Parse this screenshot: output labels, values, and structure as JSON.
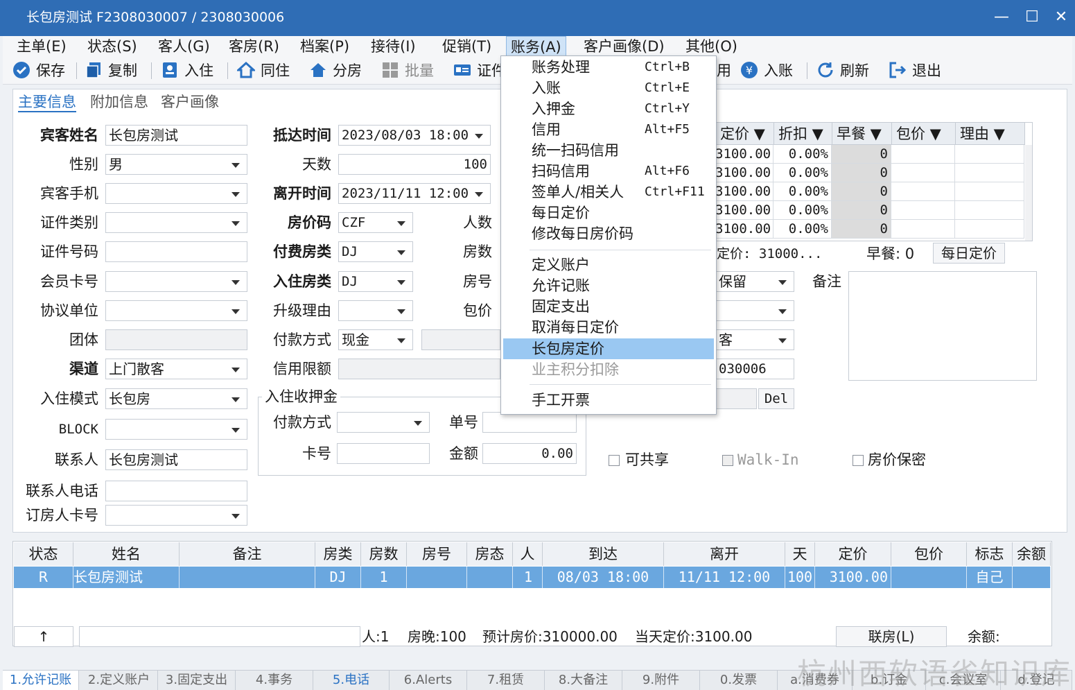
{
  "window": {
    "title": "长包房测试  F2308030007  /  2308030006",
    "minimize": "—",
    "maximize": "☐",
    "close": "✕"
  },
  "menu": [
    "主单(E)",
    "状态(S)",
    "客人(G)",
    "客房(R)",
    "档案(P)",
    "接待(I)",
    "促销(T)",
    "账务(A)",
    "客户画像(D)",
    "其他(O)"
  ],
  "toolbar": {
    "save": "保存",
    "copy": "复制",
    "checkin": "入住",
    "share": "同住",
    "assign": "分房",
    "batch": "批量",
    "cert": "证件",
    "posting": "入账",
    "refresh": "刷新",
    "exit": "退出",
    "partial": "用"
  },
  "tabs": [
    "主要信息",
    "附加信息",
    "客户画像"
  ],
  "form": {
    "guest_name_label": "宾客姓名",
    "guest_name": "长包房测试",
    "gender_label": "性别",
    "gender": "男",
    "mobile_label": "宾客手机",
    "mobile": "",
    "id_type_label": "证件类别",
    "id_type": "",
    "id_no_label": "证件号码",
    "id_no": "",
    "member_label": "会员卡号",
    "member": "",
    "company_label": "协议单位",
    "company": "",
    "group_label": "团体",
    "group": "",
    "channel_label": "渠道",
    "channel": "上门散客",
    "mode_label": "入住模式",
    "mode": "长包房",
    "block_label": "BLOCK",
    "block": "",
    "contact_label": "联系人",
    "contact": "长包房测试",
    "contact_phone_label": "联系人电话",
    "contact_phone": "",
    "booker_card_label": "订房人卡号",
    "booker_card": "",
    "arrival_label": "抵达时间",
    "arrival": "2023/08/03 18:00",
    "days_label": "天数",
    "days": "100",
    "departure_label": "离开时间",
    "departure": "2023/11/11 12:00",
    "rate_code_label": "房价码",
    "rate_code": "CZF",
    "pay_room_label": "付费房类",
    "pay_room": "DJ",
    "stay_room_label": "入住房类",
    "stay_room": "DJ",
    "upgrade_label": "升级理由",
    "upgrade": "",
    "pay_method_label": "付款方式",
    "pay_method": "现金",
    "credit_label": "信用限额",
    "credit": "",
    "persons_label": "人数",
    "rooms_label": "房数",
    "room_no_label": "房号",
    "package_label": "包价"
  },
  "deposit": {
    "title": "入住收押金",
    "pay_method_label": "付款方式",
    "pay_method": "",
    "bill_label": "单号",
    "bill": "",
    "card_label": "卡号",
    "card": "",
    "amount_label": "金额",
    "amount": "0.00"
  },
  "rate_table": {
    "headers": [
      "定价 ▼",
      "折扣 ▼",
      "早餐 ▼",
      "包价 ▼",
      "理由 ▼"
    ],
    "rows": [
      [
        "3100.00",
        "0.00%",
        "0"
      ],
      [
        "3100.00",
        "0.00%",
        "0"
      ],
      [
        "3100.00",
        "0.00%",
        "0"
      ],
      [
        "3100.00",
        "0.00%",
        "0"
      ],
      [
        "3100.00",
        "0.00%",
        "0"
      ]
    ],
    "summary": "定价: 31000...",
    "breakfast": "早餐: 0",
    "daily_btn": "每日定价"
  },
  "right": {
    "keep": "保留",
    "remark_label": "备注",
    "guest": "客",
    "account_no": "030006",
    "del_btn": "Del"
  },
  "checks": {
    "share": "可共享",
    "walkin": "Walk-In",
    "keep_rate": "房价保密"
  },
  "list": {
    "headers": [
      "状态",
      "姓名",
      "备注",
      "房类",
      "房数",
      "房号",
      "房态",
      "人",
      "到达",
      "离开",
      "天",
      "定价",
      "包价",
      "标志",
      "余额"
    ],
    "row": [
      "R",
      "长包房测试",
      "",
      "DJ",
      "1",
      "",
      "",
      "1",
      "08/03 18:00",
      "11/11 12:00",
      "100",
      "3100.00",
      "",
      "自己",
      ""
    ]
  },
  "footer": {
    "up": "↑",
    "persons": "人:1",
    "nights": "房晚:100",
    "est_rate": "预计房价:310000.00",
    "today_rate": "当天定价:3100.00",
    "link_btn": "联房(L)",
    "balance": "余额:"
  },
  "bottom_tabs": [
    "1.允许记账",
    "2.定义账户",
    "3.固定支出",
    "4.事务",
    "5.电话",
    "6.Alerts",
    "7.租赁",
    "8.大备注",
    "9.附件",
    "0.发票",
    "a.消费券",
    "b.订金",
    "c.会议室",
    "d.登记"
  ],
  "dropdown": {
    "items": [
      {
        "text": "账务处理",
        "key": "Ctrl+B"
      },
      {
        "text": "入账",
        "key": "Ctrl+E"
      },
      {
        "text": "入押金",
        "key": "Ctrl+Y"
      },
      {
        "text": "信用",
        "key": "Alt+F5"
      },
      {
        "text": "统一扫码信用",
        "key": ""
      },
      {
        "text": "扫码信用",
        "key": "Alt+F6"
      },
      {
        "text": "签单人/相关人",
        "key": "Ctrl+F11"
      },
      {
        "text": "每日定价",
        "key": ""
      },
      {
        "text": "修改每日房价码",
        "key": ""
      },
      {
        "text": "定义账户",
        "key": ""
      },
      {
        "text": "允许记账",
        "key": ""
      },
      {
        "text": "固定支出",
        "key": ""
      },
      {
        "text": "取消每日定价",
        "key": ""
      },
      {
        "text": "长包房定价",
        "key": ""
      },
      {
        "text": "业主积分扣除",
        "key": ""
      },
      {
        "text": "手工开票",
        "key": ""
      }
    ]
  },
  "watermark": "杭州西软语雀知识库",
  "colors": {
    "title_bar": "#2f6db5",
    "accent": "#2a72c3",
    "selected_row": "#6aa7df",
    "menu_highlight": "#9ac8f2"
  }
}
